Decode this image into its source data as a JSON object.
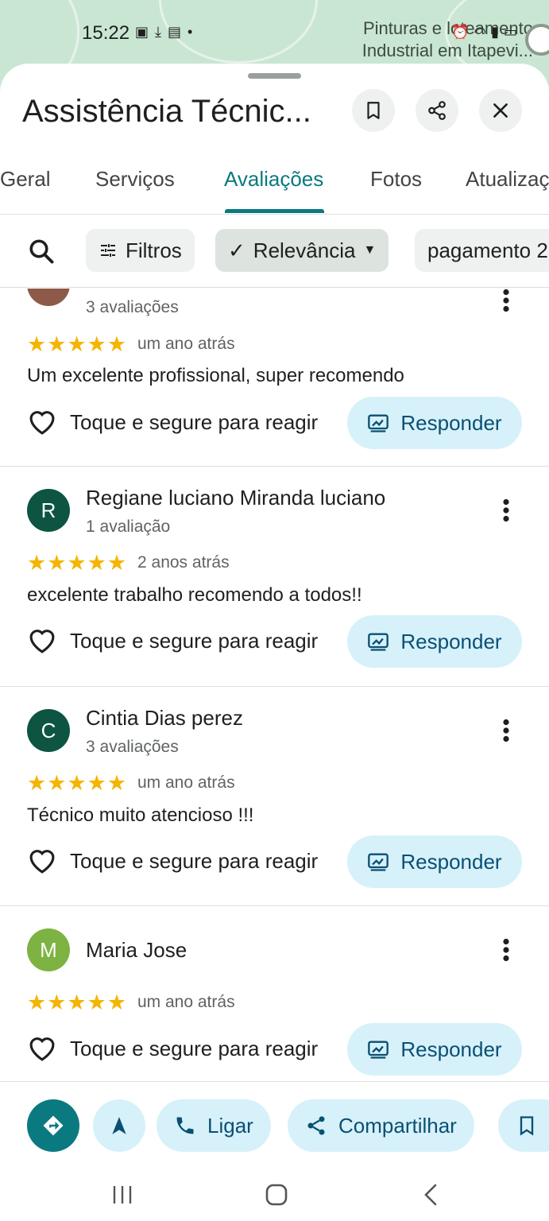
{
  "status": {
    "time": "15:22",
    "map_label_line1": "Pinturas e loteamento",
    "map_label_line2": "Industrial em Itapevi..."
  },
  "header": {
    "title": "Assistência Técnic..."
  },
  "tabs": [
    "Geral",
    "Serviços",
    "Avaliações",
    "Fotos",
    "Atualizaç"
  ],
  "filters": {
    "filtros": "Filtros",
    "relevancia": "Relevância",
    "pagamento": "pagamento 2"
  },
  "reviews": [
    {
      "name": "",
      "count": "3 avaliações",
      "when": "um ano atrás",
      "text": "Um excelente profissional, super recomendo",
      "stars": 5,
      "react": "Toque e segure para reagir",
      "respond": "Responder"
    },
    {
      "initial": "R",
      "name": "Regiane luciano Miranda luciano",
      "count": "1 avaliação",
      "when": "2 anos atrás",
      "text": "excelente trabalho recomendo a todos!!",
      "stars": 5,
      "react": "Toque e segure para reagir",
      "respond": "Responder",
      "color": "#0d5443"
    },
    {
      "initial": "C",
      "name": "Cintia Dias perez",
      "count": "3 avaliações",
      "when": "um ano atrás",
      "text": "Técnico muito  atencioso !!!",
      "stars": 5,
      "react": "Toque e segure para reagir",
      "respond": "Responder",
      "color": "#0d5443"
    },
    {
      "initial": "M",
      "name": "Maria Jose",
      "count": "",
      "when": "um ano atrás",
      "text": "",
      "stars": 5,
      "react": "Toque e segure para reagir",
      "respond": "Responder",
      "color": "#7cb342"
    }
  ],
  "actions": {
    "ligar": "Ligar",
    "compartilhar": "Compartilhar"
  },
  "colors": {
    "accent": "#0a7a80",
    "chip": "#d6f1fa",
    "star": "#f5b400"
  }
}
